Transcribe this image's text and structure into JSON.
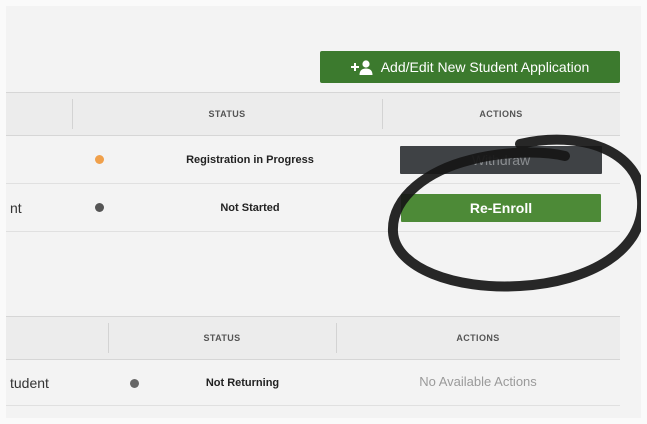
{
  "header": {
    "add_button_label": "Add/Edit New Student Application",
    "add_button_icon": "add-person-icon"
  },
  "enrolled_table": {
    "columns": [
      "",
      "STATUS",
      "ACTIONS"
    ],
    "rows": [
      {
        "name": "",
        "status": "Registration in Progress",
        "status_color": "#f0a04b",
        "action": "Withdraw"
      },
      {
        "name": "nt",
        "status": "Not Started",
        "status_color": "#555555",
        "action": "Re-Enroll"
      }
    ]
  },
  "returning_table": {
    "columns": [
      "",
      "STATUS",
      "ACTIONS"
    ],
    "rows": [
      {
        "name": "tudent",
        "status": "Not Returning",
        "status_color": "#666666",
        "action": "No Available Actions"
      }
    ]
  },
  "colors": {
    "primary_green": "#3c7a2e",
    "reenroll_green": "#4d8a37",
    "withdraw_dark": "#3f4245",
    "in_progress_dot": "#f0a04b"
  }
}
